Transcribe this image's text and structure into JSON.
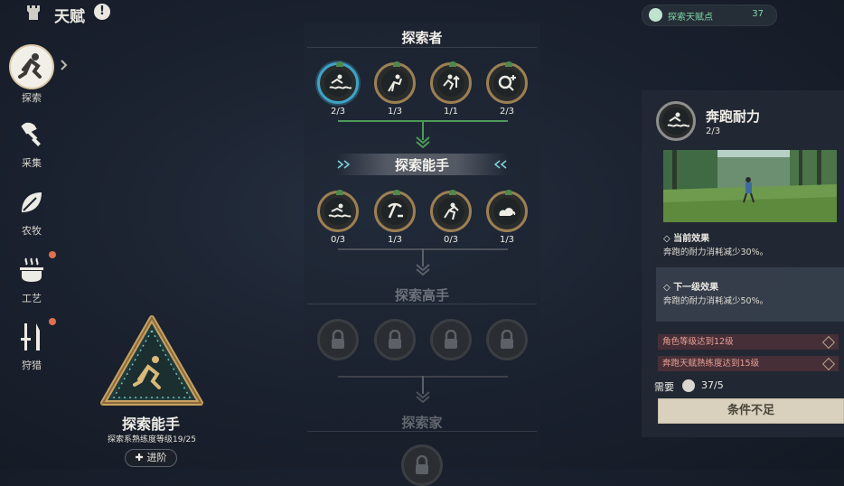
{
  "header": {
    "title": "天赋",
    "points_label": "探索天赋点",
    "points_value": "37"
  },
  "sidebar": {
    "items": [
      {
        "label": "探索",
        "icon": "explore-runner-icon",
        "active": true
      },
      {
        "label": "采集",
        "icon": "axe-icon"
      },
      {
        "label": "农牧",
        "icon": "leaf-icon"
      },
      {
        "label": "工艺",
        "icon": "cooking-pot-icon",
        "notify": true
      },
      {
        "label": "狩猎",
        "icon": "hunting-tools-icon",
        "notify": true
      }
    ]
  },
  "tiers": [
    {
      "title": "探索者",
      "nodes": [
        {
          "count": "2/3",
          "icon": "swim-stamina-icon",
          "selected": true
        },
        {
          "count": "1/3",
          "icon": "climb-icon"
        },
        {
          "count": "1/1",
          "icon": "sprint-up-icon"
        },
        {
          "count": "2/3",
          "icon": "search-plus-icon"
        }
      ]
    },
    {
      "title": "探索能手",
      "nodes": [
        {
          "count": "0/3",
          "icon": "swim-icon"
        },
        {
          "count": "1/3",
          "icon": "pickaxe-icon"
        },
        {
          "count": "0/3",
          "icon": "jump-icon"
        },
        {
          "count": "1/3",
          "icon": "cloud-star-icon"
        }
      ]
    },
    {
      "title": "探索高手",
      "locked": true,
      "nodes": [
        {
          "icon": "lock-icon"
        },
        {
          "icon": "lock-icon"
        },
        {
          "icon": "lock-icon"
        },
        {
          "icon": "lock-icon"
        }
      ]
    },
    {
      "title": "探索家",
      "locked": true,
      "nodes": [
        {
          "icon": "lock-icon"
        }
      ]
    }
  ],
  "badge": {
    "title": "探索能手",
    "progress_text": "探索系熟练度等级19/25",
    "advance_label": "进阶",
    "advance_icon": "plus-icon"
  },
  "detail": {
    "title": "奔跑耐力",
    "level": "2/3",
    "current_label": "当前效果",
    "current_text": "奔跑的耐力消耗减少30%。",
    "next_label": "下一级效果",
    "next_text": "奔跑的耐力消耗减少50%。",
    "requirements": [
      "角色等级达到12级",
      "奔跑天赋熟练度达到15级"
    ],
    "need_label": "需要",
    "need_value": "37/5",
    "button_label": "条件不足"
  },
  "colors": {
    "accent_green": "#7fd9a5",
    "selected_ring": "#3fa3c7",
    "node_ring": "#9c7f53",
    "warning": "#e7a096"
  }
}
